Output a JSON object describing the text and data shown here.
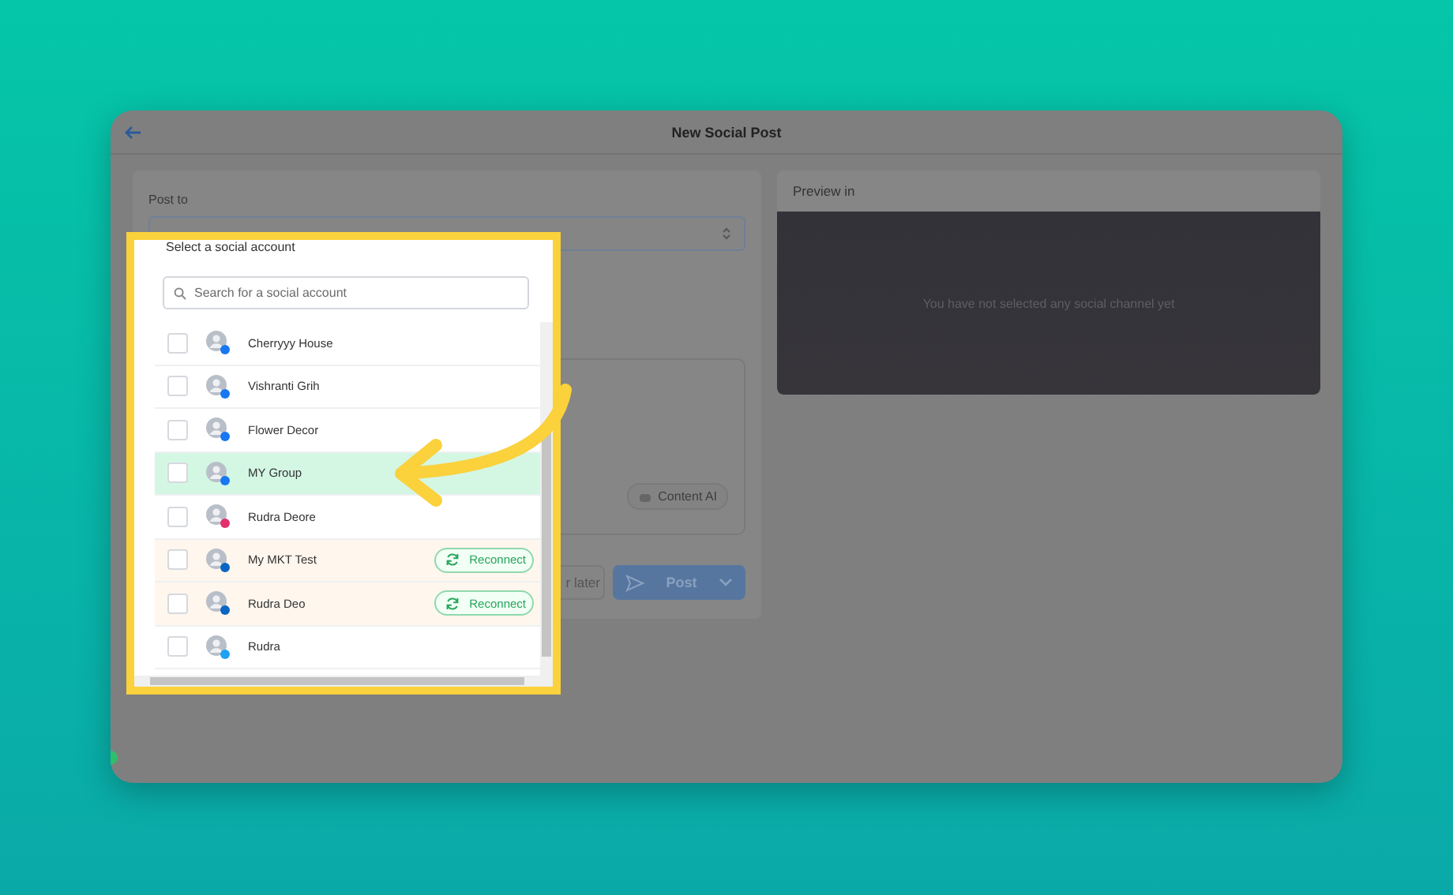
{
  "window": {
    "title": "New Social Post"
  },
  "post_to": {
    "label": "Post to",
    "select_value": "Select a social account"
  },
  "editor": {
    "content_ai": "Content AI"
  },
  "actions": {
    "schedule": "r later",
    "post": "Post"
  },
  "preview": {
    "title": "Preview in",
    "empty_message": "You have not selected any social channel yet"
  },
  "dropdown": {
    "search_placeholder": "Search for a social account",
    "accounts": [
      {
        "name": "Cherryyy House",
        "kind": "connected",
        "checked": false,
        "highlighted": false,
        "color": "#1877f2"
      },
      {
        "name": "Vishranti Grih",
        "kind": "connected",
        "checked": false,
        "highlighted": false,
        "color": "#1877f2"
      },
      {
        "name": "Flower Decor",
        "kind": "connected",
        "checked": false,
        "highlighted": false,
        "color": "#1877f2"
      },
      {
        "name": "MY Group",
        "kind": "connected",
        "checked": false,
        "highlighted": true,
        "color": "#1877f2"
      },
      {
        "name": "Rudra Deore",
        "kind": "connected",
        "checked": false,
        "highlighted": false,
        "color": "#e1306c"
      },
      {
        "name": "My MKT Test",
        "kind": "expired",
        "checked": false,
        "highlighted": false,
        "color": "#0a66c2",
        "action": "Reconnect"
      },
      {
        "name": "Rudra Deo",
        "kind": "expired",
        "checked": false,
        "highlighted": false,
        "color": "#0a66c2",
        "action": "Reconnect"
      },
      {
        "name": "Rudra",
        "kind": "connected",
        "checked": false,
        "highlighted": false,
        "color": "#1da1f2"
      }
    ]
  }
}
